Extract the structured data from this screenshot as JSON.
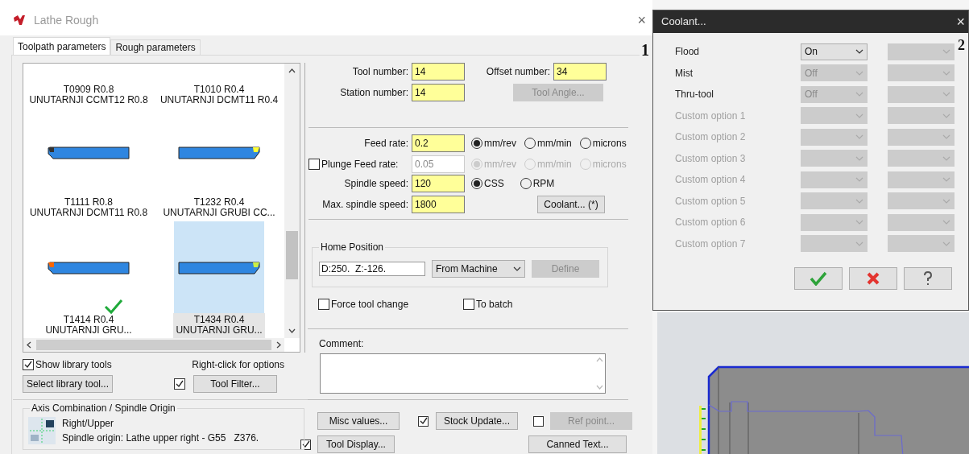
{
  "main_window": {
    "title": "Lathe Rough",
    "close": "×",
    "annotation": "1"
  },
  "tabs": [
    {
      "label": "Toolpath parameters",
      "selected": true
    },
    {
      "label": "Rough parameters",
      "selected": false
    }
  ],
  "tools": [
    {
      "name": "T0909 R0.8",
      "description": "UNUTARNJI CCMT12 R0.8",
      "selected": false,
      "checked": false
    },
    {
      "name": "T1010 R0.4",
      "description": "UNUTARNJI DCMT11 R0.4",
      "selected": false,
      "checked": false
    },
    {
      "name": "T1111 R0.8",
      "description": "UNUTARNJI DCMT11 R0.8",
      "selected": false,
      "checked": false,
      "color": "#333333"
    },
    {
      "name": "T1232 R0.4",
      "description": "UNUTARNJI GRUBI CC...",
      "selected": false,
      "checked": false,
      "color": "#ffff33"
    },
    {
      "name": "T1414 R0.4",
      "description": "UNUTARNJI GRU...",
      "selected": false,
      "checked": true,
      "color": "#ff6600"
    },
    {
      "name": "T1434 R0.4",
      "description": "UNUTARNJI GRU...",
      "selected": true,
      "checked": false,
      "color": "#ccee44"
    }
  ],
  "show_library_tools": {
    "label": "Show library tools",
    "checked": true
  },
  "right_click_hint": "Right-click for options",
  "select_library_tool": "Select library tool...",
  "tool_filter": {
    "label": "Tool Filter...",
    "checked": true
  },
  "axis_combination": {
    "legend": "Axis Combination / Spindle Origin",
    "mode": "Right/Upper",
    "origin": "Spindle origin: Lathe upper right - G55   Z376."
  },
  "tool_number": {
    "label": "Tool number:",
    "value": "14"
  },
  "offset_number": {
    "label": "Offset number:",
    "value": "34"
  },
  "station_number": {
    "label": "Station number:",
    "value": "14"
  },
  "tool_angle": {
    "label": "Tool Angle...",
    "disabled": true
  },
  "feed_rate": {
    "label": "Feed rate:",
    "value": "0.2",
    "units": [
      {
        "label": "mm/rev",
        "selected": true
      },
      {
        "label": "mm/min",
        "selected": false
      },
      {
        "label": "microns",
        "selected": false
      }
    ]
  },
  "plunge_feed_rate": {
    "label": "Plunge Feed rate:",
    "checked": false,
    "value": "0.05",
    "units": [
      {
        "label": "mm/rev",
        "selected": true
      },
      {
        "label": "mm/min",
        "selected": false
      },
      {
        "label": "microns",
        "selected": false
      }
    ]
  },
  "spindle_speed": {
    "label": "Spindle speed:",
    "value": "120",
    "modes": [
      {
        "label": "CSS",
        "selected": true
      },
      {
        "label": "RPM",
        "selected": false
      }
    ]
  },
  "max_spindle_speed": {
    "label": "Max. spindle speed:",
    "value": "1800"
  },
  "coolant_button": "Coolant... (*)",
  "home_position": {
    "legend": "Home Position",
    "value": "D:250.  Z:-126.",
    "source": "From Machine",
    "define": {
      "label": "Define",
      "disabled": true
    }
  },
  "force_tool_change": {
    "label": "Force tool change",
    "checked": false
  },
  "to_batch": {
    "label": "To batch",
    "checked": false
  },
  "comment": {
    "label": "Comment:"
  },
  "misc_values": "Misc values...",
  "stock_update": {
    "label": "Stock Update...",
    "checked": true
  },
  "ref_point": {
    "label": "Ref point...",
    "checked": false,
    "disabled": true
  },
  "tool_display": {
    "label": "Tool Display...",
    "checked": true
  },
  "canned_text": "Canned Text...",
  "coolant_dialog": {
    "title": "Coolant...",
    "close": "×",
    "annotation": "2",
    "rows": [
      {
        "kind": "standard",
        "label": "Flood",
        "value": "On",
        "disabled": false
      },
      {
        "kind": "standard",
        "label": "Mist",
        "value": "Off",
        "disabled": true
      },
      {
        "kind": "standard",
        "label": "Thru-tool",
        "value": "Off",
        "disabled": true
      },
      {
        "kind": "custom",
        "label": "Custom option 1",
        "disabled": true
      },
      {
        "kind": "custom",
        "label": "Custom option 2",
        "disabled": true
      },
      {
        "kind": "custom",
        "label": "Custom option 3",
        "disabled": true
      },
      {
        "kind": "custom",
        "label": "Custom option 4",
        "disabled": true
      },
      {
        "kind": "custom",
        "label": "Custom option 5",
        "disabled": true
      },
      {
        "kind": "custom",
        "label": "Custom option 6",
        "disabled": true
      },
      {
        "kind": "custom",
        "label": "Custom option 7",
        "disabled": true
      }
    ]
  }
}
